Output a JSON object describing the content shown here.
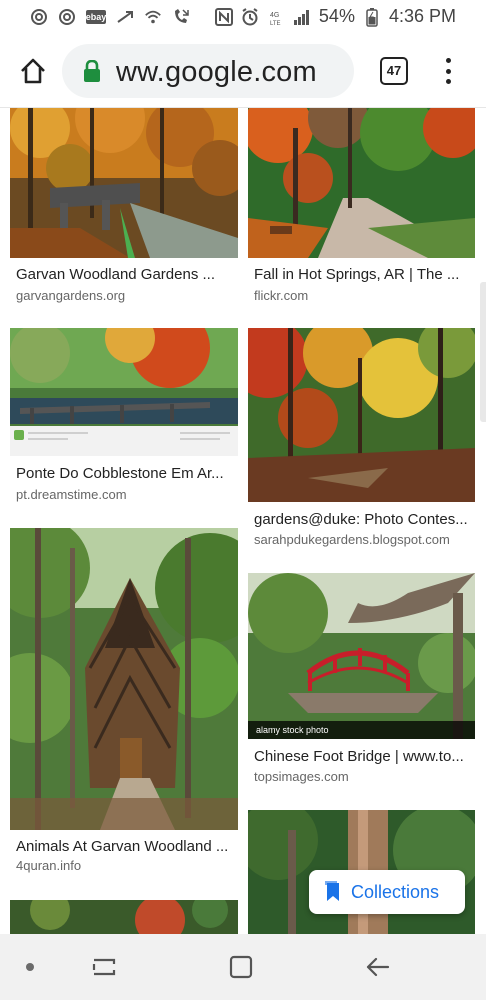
{
  "status_bar": {
    "battery": "54%",
    "time": "4:36 PM",
    "left_icons": [
      "at-icon",
      "at-icon",
      "ebay-icon",
      "airplane-up-icon",
      "wifi-icon",
      "missed-call-icon"
    ],
    "ebay_label": "ebay",
    "right_icons": [
      "nfc-icon",
      "alarm-icon",
      "volte-icon",
      "signal-icon",
      "battery-icon"
    ]
  },
  "toolbar": {
    "url": "ww.google.com",
    "tab_count": "47",
    "lock_color": "#1e8e3e"
  },
  "results": [
    {
      "title": "Garvan Woodland Gardens ...",
      "source": "garvangardens.org"
    },
    {
      "title": "Fall in Hot Springs, AR | The ...",
      "source": "flickr.com"
    },
    {
      "title": "Ponte Do Cobblestone Em Ar...",
      "source": "pt.dreamstime.com"
    },
    {
      "title": "gardens@duke: Photo Contes...",
      "source": "sarahpdukegardens.blogspot.com"
    },
    {
      "title": "Animals At Garvan Woodland ...",
      "source": "4quran.info"
    },
    {
      "title": "Chinese Foot Bridge | www.to...",
      "source": "topsimages.com"
    }
  ],
  "watermark": "alamy stock photo",
  "collections": {
    "label": "Collections",
    "color": "#1a73e8"
  }
}
